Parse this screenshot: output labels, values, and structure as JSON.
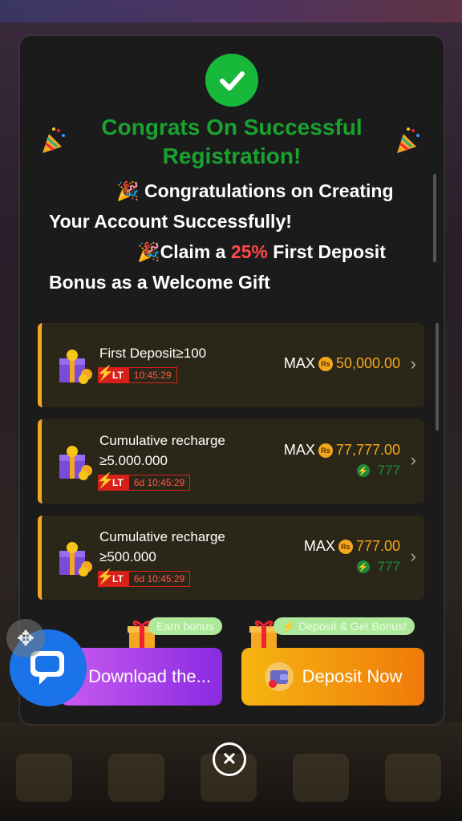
{
  "modal": {
    "title": "Congrats On Successful Registration!",
    "message": {
      "line1": "🎉 Congratulations on Creating Your Account Successfully!",
      "line2_prefix": "🎉Claim a ",
      "line2_highlight": "25%",
      "line2_suffix": " First Deposit Bonus as a Welcome Gift"
    }
  },
  "cards": [
    {
      "title": "First Deposit≥100",
      "tag": "LT",
      "time": "10:45:29",
      "max_label": "MAX",
      "currency": "Rs",
      "amount": "50,000.00",
      "bonus": ""
    },
    {
      "title": "Cumulative recharge ≥5.000.000",
      "tag": "LT",
      "time": "6d 10:45:29",
      "max_label": "MAX",
      "currency": "Rs",
      "amount": "77,777.00",
      "bonus": "777"
    },
    {
      "title": "Cumulative recharge ≥500.000",
      "tag": "LT",
      "time": "6d 10:45:29",
      "max_label": "MAX",
      "currency": "Rs",
      "amount": "777.00",
      "bonus": "777"
    }
  ],
  "actions": {
    "download_label": "Download the...",
    "download_pill": "Earn bonus",
    "deposit_label": "Deposit Now",
    "deposit_pill": "⚡ Deposit & Get Bonus!"
  },
  "colors": {
    "success": "#18b83a",
    "accent": "#f5a623",
    "highlight": "#ff4a4a",
    "chat": "#1a73e8"
  },
  "icons": [
    "check-icon",
    "party-popper-icon",
    "gift-icon",
    "lightning-icon",
    "chevron-right-icon",
    "chat-icon",
    "move-icon",
    "close-icon",
    "wallet-icon"
  ]
}
